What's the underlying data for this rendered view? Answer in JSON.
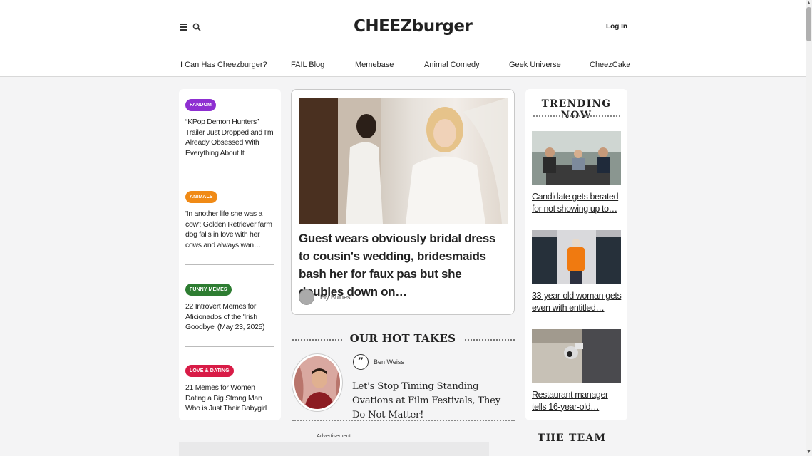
{
  "header": {
    "logo_text": "CHEEZburger",
    "login_label": "Log In"
  },
  "nav": {
    "items": [
      {
        "label": "I Can Has Cheezburger?"
      },
      {
        "label": "FAIL Blog"
      },
      {
        "label": "Memebase"
      },
      {
        "label": "Animal Comedy"
      },
      {
        "label": "Geek Universe"
      },
      {
        "label": "CheezCake"
      }
    ]
  },
  "left_articles": [
    {
      "category": "FANDOM",
      "category_color": "#8e2fd1",
      "title": "“KPop Demon Hunters” Trailer Just Dropped and I'm Already Obsessed With Everything About It"
    },
    {
      "category": "ANIMALS",
      "category_color": "#f08a16",
      "title": "'In another life she was a cow': Golden Retriever farm dog falls in love with her cows and always wan…"
    },
    {
      "category": "FUNNY MEMES",
      "category_color": "#2e7d32",
      "title": "22 Introvert Memes for Aficionados of the 'Irish Goodbye' (May 23, 2025)"
    },
    {
      "category": "LOVE & DATING",
      "category_color": "#d81b46",
      "title": "21 Memes for Women Dating a Big Strong Man Who is Just Their Babygirl"
    }
  ],
  "featured": {
    "title": "Guest wears obviously bridal dress to cousin's wedding, bridesmaids bash her for faux pas but she doubles down on…",
    "author": "Ely Bulnes"
  },
  "hot_takes": {
    "heading": "OUR HOT TAKES",
    "quote_glyph": "”",
    "author": "Ben Weiss",
    "title": "Let's Stop Timing Standing Ovations at Film Festivals, They Do Not Matter!"
  },
  "advertisement_label": "Advertisement",
  "trending": {
    "heading": "TRENDING NOW",
    "items": [
      {
        "title": "Candidate gets berated for not showing up to…"
      },
      {
        "title": "33-year-old woman gets even with entitled…"
      },
      {
        "title": "Restaurant manager tells 16-year-old…"
      }
    ]
  },
  "team_heading": "THE TEAM",
  "colors": {
    "page_background": "#f4f4f5",
    "card_background": "#ffffff",
    "text": "#222222"
  },
  "icons": [
    "menu-icon",
    "search-icon",
    "burger-logo-icon",
    "quote-icon",
    "scroll-up-arrow",
    "scroll-down-arrow"
  ]
}
